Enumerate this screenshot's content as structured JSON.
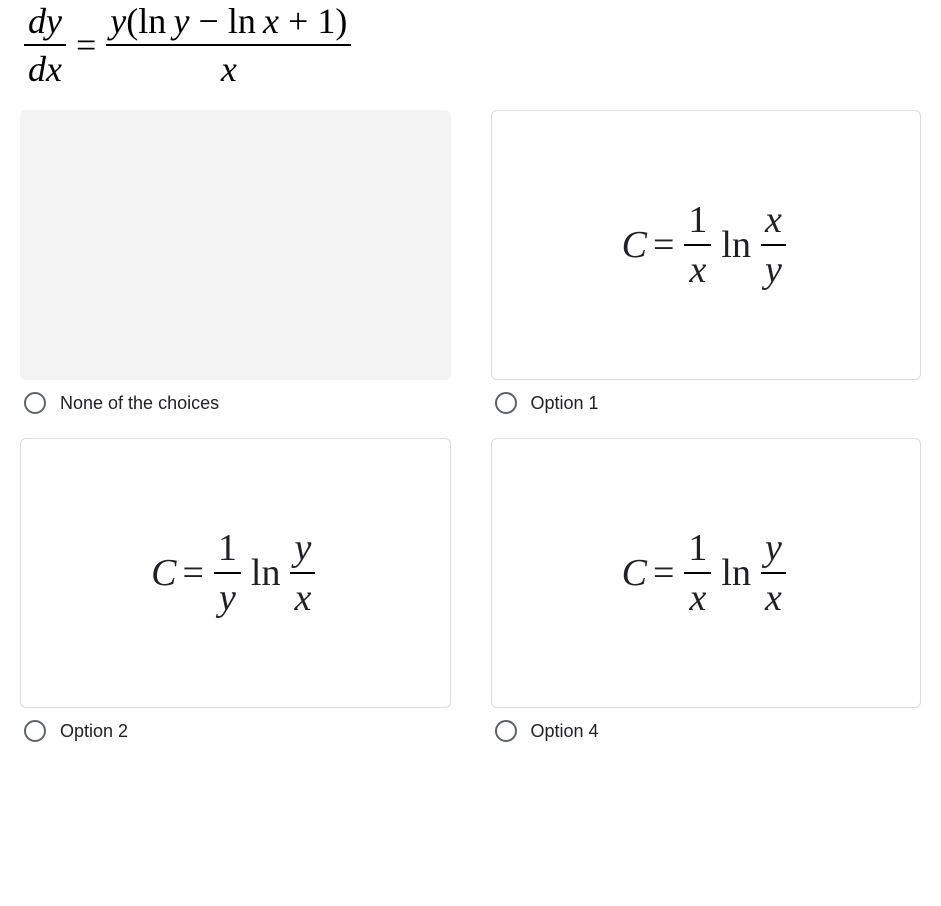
{
  "question": {
    "lhs_num": "dy",
    "lhs_den": "dx",
    "eq": "=",
    "rhs_num_pre": "y",
    "rhs_num_open": "(",
    "rhs_num_ln1": "ln",
    "rhs_num_y": "y",
    "rhs_num_minus": "−",
    "rhs_num_ln2": "ln",
    "rhs_num_x": "x",
    "rhs_num_plus": "+",
    "rhs_num_one": "1",
    "rhs_num_close": ")",
    "rhs_den": "x"
  },
  "options": {
    "none": {
      "label": "None of the choices"
    },
    "opt1": {
      "label": "Option 1",
      "C": "C",
      "eq": "=",
      "f1_num": "1",
      "f1_den": "x",
      "ln": "ln",
      "f2_num": "x",
      "f2_den": "y"
    },
    "opt2": {
      "label": "Option 2",
      "C": "C",
      "eq": "=",
      "f1_num": "1",
      "f1_den": "y",
      "ln": "ln",
      "f2_num": "y",
      "f2_den": "x"
    },
    "opt4": {
      "label": "Option 4",
      "C": "C",
      "eq": "=",
      "f1_num": "1",
      "f1_den": "x",
      "ln": "ln",
      "f2_num": "y",
      "f2_den": "x"
    }
  }
}
